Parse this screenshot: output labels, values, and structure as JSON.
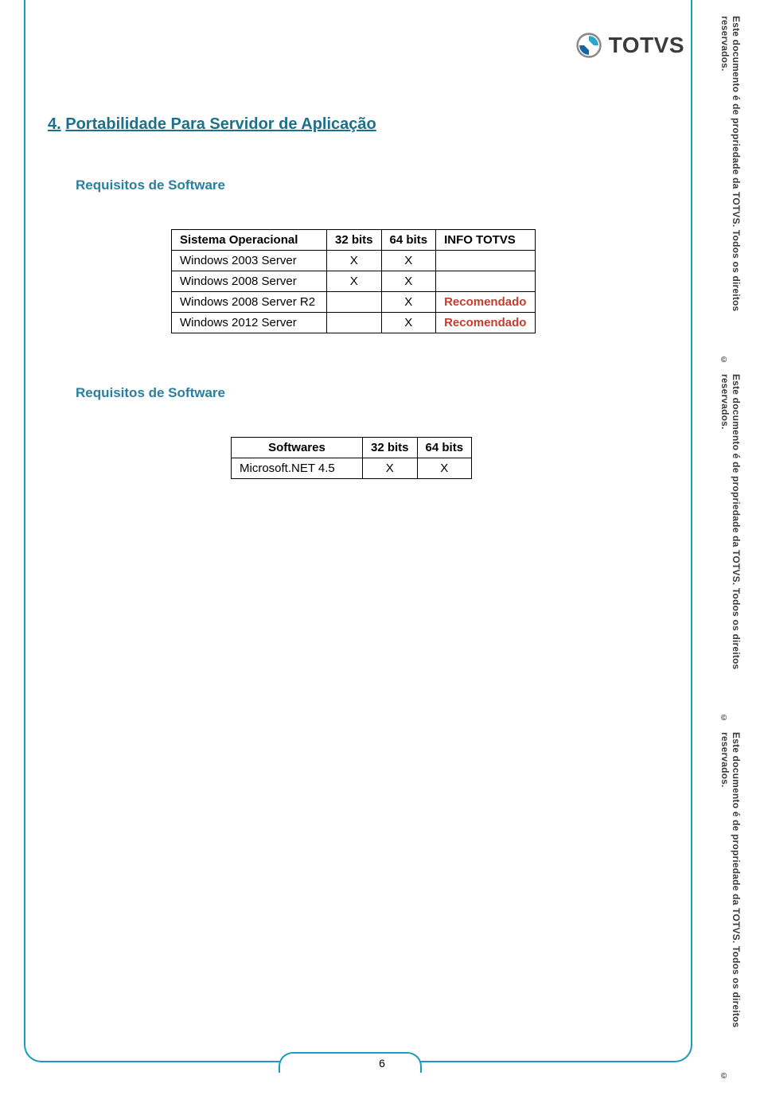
{
  "logo_text": "TOTVS",
  "section_number": "4.",
  "section_title": "Portabilidade Para Servidor de Aplicação",
  "sub_heading_1": "Requisitos de Software",
  "table1": {
    "headers": [
      "Sistema Operacional",
      "32 bits",
      "64 bits",
      "INFO TOTVS"
    ],
    "rows": [
      {
        "os": "Windows 2003 Server",
        "b32": "X",
        "b64": "X",
        "info": ""
      },
      {
        "os": "Windows 2008 Server",
        "b32": "X",
        "b64": "X",
        "info": ""
      },
      {
        "os": "Windows 2008 Server R2",
        "b32": "",
        "b64": "X",
        "info": "Recomendado"
      },
      {
        "os": "Windows 2012 Server",
        "b32": "",
        "b64": "X",
        "info": "Recomendado"
      }
    ]
  },
  "sub_heading_2": "Requisitos de Software",
  "table2": {
    "headers": [
      "Softwares",
      "32 bits",
      "64 bits"
    ],
    "rows": [
      {
        "sw": "Microsoft.NET 4.5",
        "b32": "X",
        "b64": "X"
      }
    ]
  },
  "side_text": "Este documento é de propriedade da TOTVS. Todos os direitos reservados.",
  "side_cc": "©",
  "page_number": "6"
}
